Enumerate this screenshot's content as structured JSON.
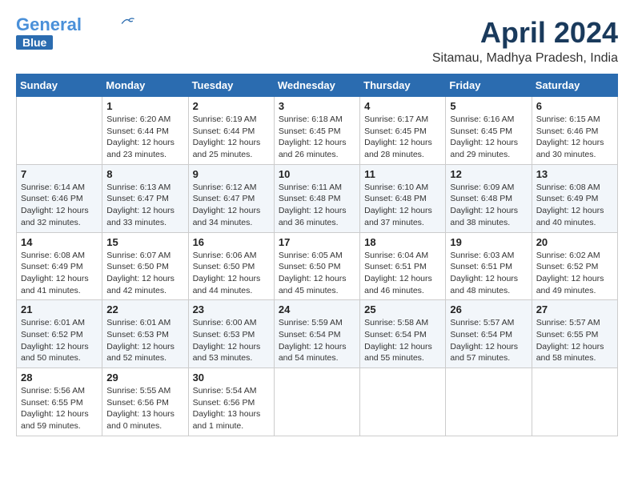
{
  "header": {
    "logo_line1": "General",
    "logo_line2": "Blue",
    "month_title": "April 2024",
    "subtitle": "Sitamau, Madhya Pradesh, India"
  },
  "columns": [
    "Sunday",
    "Monday",
    "Tuesday",
    "Wednesday",
    "Thursday",
    "Friday",
    "Saturday"
  ],
  "weeks": [
    [
      {
        "day": "",
        "info": ""
      },
      {
        "day": "1",
        "info": "Sunrise: 6:20 AM\nSunset: 6:44 PM\nDaylight: 12 hours\nand 23 minutes."
      },
      {
        "day": "2",
        "info": "Sunrise: 6:19 AM\nSunset: 6:44 PM\nDaylight: 12 hours\nand 25 minutes."
      },
      {
        "day": "3",
        "info": "Sunrise: 6:18 AM\nSunset: 6:45 PM\nDaylight: 12 hours\nand 26 minutes."
      },
      {
        "day": "4",
        "info": "Sunrise: 6:17 AM\nSunset: 6:45 PM\nDaylight: 12 hours\nand 28 minutes."
      },
      {
        "day": "5",
        "info": "Sunrise: 6:16 AM\nSunset: 6:45 PM\nDaylight: 12 hours\nand 29 minutes."
      },
      {
        "day": "6",
        "info": "Sunrise: 6:15 AM\nSunset: 6:46 PM\nDaylight: 12 hours\nand 30 minutes."
      }
    ],
    [
      {
        "day": "7",
        "info": "Sunrise: 6:14 AM\nSunset: 6:46 PM\nDaylight: 12 hours\nand 32 minutes."
      },
      {
        "day": "8",
        "info": "Sunrise: 6:13 AM\nSunset: 6:47 PM\nDaylight: 12 hours\nand 33 minutes."
      },
      {
        "day": "9",
        "info": "Sunrise: 6:12 AM\nSunset: 6:47 PM\nDaylight: 12 hours\nand 34 minutes."
      },
      {
        "day": "10",
        "info": "Sunrise: 6:11 AM\nSunset: 6:48 PM\nDaylight: 12 hours\nand 36 minutes."
      },
      {
        "day": "11",
        "info": "Sunrise: 6:10 AM\nSunset: 6:48 PM\nDaylight: 12 hours\nand 37 minutes."
      },
      {
        "day": "12",
        "info": "Sunrise: 6:09 AM\nSunset: 6:48 PM\nDaylight: 12 hours\nand 38 minutes."
      },
      {
        "day": "13",
        "info": "Sunrise: 6:08 AM\nSunset: 6:49 PM\nDaylight: 12 hours\nand 40 minutes."
      }
    ],
    [
      {
        "day": "14",
        "info": "Sunrise: 6:08 AM\nSunset: 6:49 PM\nDaylight: 12 hours\nand 41 minutes."
      },
      {
        "day": "15",
        "info": "Sunrise: 6:07 AM\nSunset: 6:50 PM\nDaylight: 12 hours\nand 42 minutes."
      },
      {
        "day": "16",
        "info": "Sunrise: 6:06 AM\nSunset: 6:50 PM\nDaylight: 12 hours\nand 44 minutes."
      },
      {
        "day": "17",
        "info": "Sunrise: 6:05 AM\nSunset: 6:50 PM\nDaylight: 12 hours\nand 45 minutes."
      },
      {
        "day": "18",
        "info": "Sunrise: 6:04 AM\nSunset: 6:51 PM\nDaylight: 12 hours\nand 46 minutes."
      },
      {
        "day": "19",
        "info": "Sunrise: 6:03 AM\nSunset: 6:51 PM\nDaylight: 12 hours\nand 48 minutes."
      },
      {
        "day": "20",
        "info": "Sunrise: 6:02 AM\nSunset: 6:52 PM\nDaylight: 12 hours\nand 49 minutes."
      }
    ],
    [
      {
        "day": "21",
        "info": "Sunrise: 6:01 AM\nSunset: 6:52 PM\nDaylight: 12 hours\nand 50 minutes."
      },
      {
        "day": "22",
        "info": "Sunrise: 6:01 AM\nSunset: 6:53 PM\nDaylight: 12 hours\nand 52 minutes."
      },
      {
        "day": "23",
        "info": "Sunrise: 6:00 AM\nSunset: 6:53 PM\nDaylight: 12 hours\nand 53 minutes."
      },
      {
        "day": "24",
        "info": "Sunrise: 5:59 AM\nSunset: 6:54 PM\nDaylight: 12 hours\nand 54 minutes."
      },
      {
        "day": "25",
        "info": "Sunrise: 5:58 AM\nSunset: 6:54 PM\nDaylight: 12 hours\nand 55 minutes."
      },
      {
        "day": "26",
        "info": "Sunrise: 5:57 AM\nSunset: 6:54 PM\nDaylight: 12 hours\nand 57 minutes."
      },
      {
        "day": "27",
        "info": "Sunrise: 5:57 AM\nSunset: 6:55 PM\nDaylight: 12 hours\nand 58 minutes."
      }
    ],
    [
      {
        "day": "28",
        "info": "Sunrise: 5:56 AM\nSunset: 6:55 PM\nDaylight: 12 hours\nand 59 minutes."
      },
      {
        "day": "29",
        "info": "Sunrise: 5:55 AM\nSunset: 6:56 PM\nDaylight: 13 hours\nand 0 minutes."
      },
      {
        "day": "30",
        "info": "Sunrise: 5:54 AM\nSunset: 6:56 PM\nDaylight: 13 hours\nand 1 minute."
      },
      {
        "day": "",
        "info": ""
      },
      {
        "day": "",
        "info": ""
      },
      {
        "day": "",
        "info": ""
      },
      {
        "day": "",
        "info": ""
      }
    ]
  ]
}
